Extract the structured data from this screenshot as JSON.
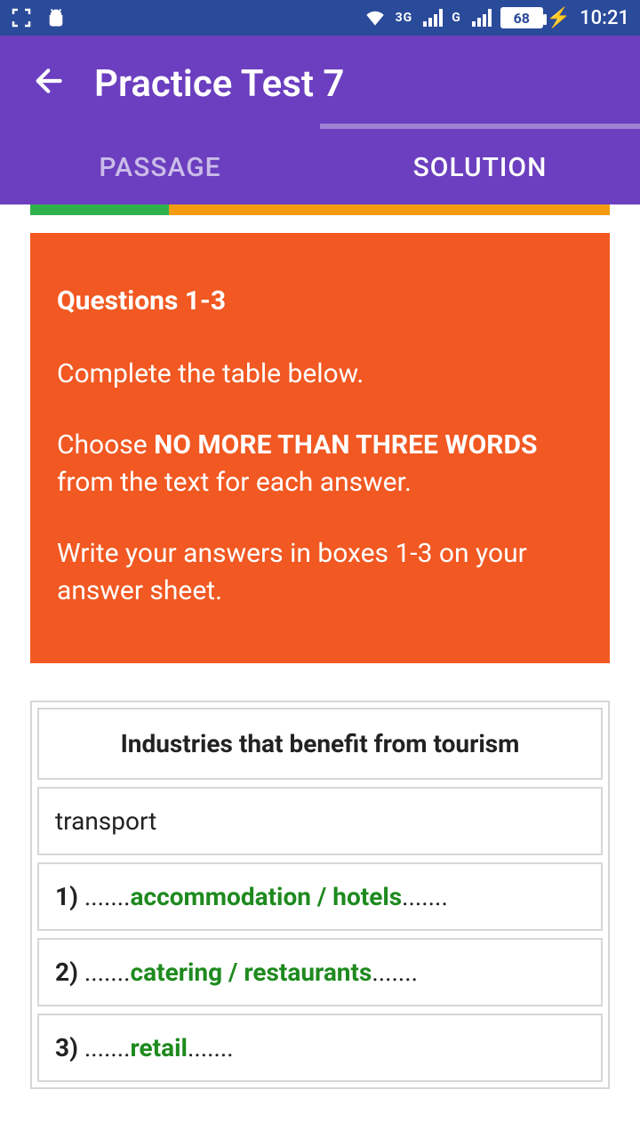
{
  "status": {
    "battery": "68",
    "time": "10:21",
    "net1_label": "3G",
    "net2_label": "G"
  },
  "header": {
    "title": "Practice Test 7",
    "tabs": {
      "passage": "PASSAGE",
      "solution": "SOLUTION"
    }
  },
  "instructions": {
    "heading": "Questions 1-3",
    "line1": "Complete the table below.",
    "line2_pre": "Choose ",
    "line2_bold": "NO MORE THAN THREE WORDS",
    "line2_post": " from the text for each answer.",
    "line3": "Write your answers in boxes 1-3 on your answer sheet."
  },
  "table": {
    "title": "Industries that benefit from tourism",
    "static_row": "transport",
    "dots": ".......",
    "rows": [
      {
        "num": "1)",
        "answer": "accommodation / hotels"
      },
      {
        "num": "2)",
        "answer": "catering / restaurants"
      },
      {
        "num": "3)",
        "answer": "retail"
      }
    ]
  }
}
